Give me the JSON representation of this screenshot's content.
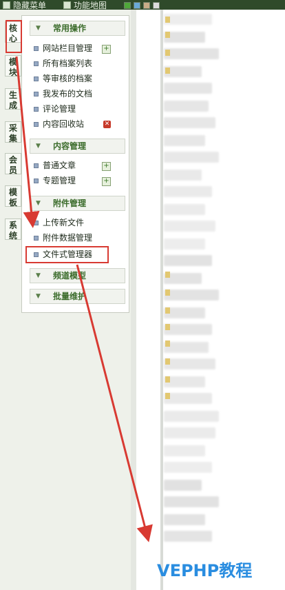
{
  "topbar": {
    "hide_menu": "隐藏菜单",
    "func_map": "功能地图",
    "swatches": [
      "#4fa83a",
      "#6aa9d8",
      "#c8ac88",
      "#dcdcdc"
    ]
  },
  "tabs": [
    "核心",
    "模块",
    "生成",
    "采集",
    "会员",
    "模板",
    "系统"
  ],
  "menu": {
    "sections": [
      {
        "title": "常用操作",
        "items": [
          "网站栏目管理",
          "所有档案列表",
          "等审核的档案",
          "我发布的文档",
          "评论管理",
          "内容回收站"
        ]
      },
      {
        "title": "内容管理",
        "items": [
          "普通文章",
          "专题管理"
        ]
      },
      {
        "title": "附件管理",
        "items": [
          "上传新文件",
          "附件数据管理",
          "文件式管理器"
        ]
      },
      {
        "title": "频道模型",
        "items": []
      },
      {
        "title": "批量维护",
        "items": []
      }
    ]
  },
  "colors": {
    "topbar": "#2f4a2a",
    "accent_green": "#3a6b2a",
    "annotation_red": "#d83a32",
    "watermark_blue": "#2a8de0"
  },
  "watermark": "VEPHP教程"
}
